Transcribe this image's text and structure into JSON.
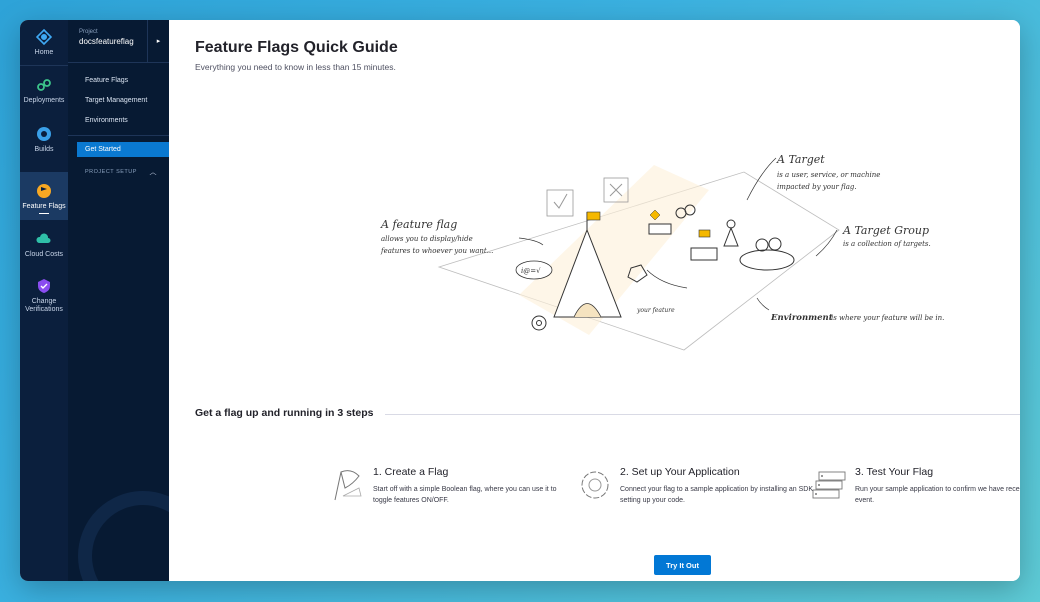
{
  "nav_rail": {
    "items": [
      {
        "label": "Home",
        "icon": "harness-logo-icon"
      },
      {
        "label": "Deployments",
        "icon": "deployments-icon"
      },
      {
        "label": "Builds",
        "icon": "builds-icon"
      },
      {
        "label": "Feature Flags",
        "icon": "feature-flags-icon",
        "active": true
      },
      {
        "label": "Cloud Costs",
        "icon": "cloud-costs-icon"
      },
      {
        "label": "Change Verifications",
        "icon": "change-verifications-icon"
      }
    ]
  },
  "project": {
    "label": "Project",
    "name": "docsfeatureflag"
  },
  "side_nav": {
    "links": [
      "Feature Flags",
      "Target Management",
      "Environments"
    ],
    "active": "Get Started",
    "section": "PROJECT SETUP"
  },
  "page": {
    "title": "Feature Flags Quick Guide",
    "subtitle": "Everything you need to know in less than 15 minutes."
  },
  "illustration": {
    "feature_flag_title": "A feature flag",
    "feature_flag_desc1": "allows you to display/hide",
    "feature_flag_desc2": "features to whoever you want...",
    "target_title": "A Target",
    "target_desc1": "is a user, service, or machine",
    "target_desc2": "impacted by your flag.",
    "group_title": "A Target Group",
    "group_desc": "is a collection of targets.",
    "env_title": "Environment",
    "env_desc": "is where your feature will be in.",
    "your_feature": "your feature"
  },
  "steps": {
    "heading": "Get a flag up and running in 3 steps",
    "items": [
      {
        "title": "1. Create a Flag",
        "desc": "Start off with a simple Boolean flag, where you can use it to toggle features ON/OFF.",
        "icon": "flag-icon"
      },
      {
        "title": "2. Set up Your Application",
        "desc": "Connect your flag to a sample application by installing an SDK setting up your code.",
        "icon": "gear-icon"
      },
      {
        "title": "3. Test Your Flag",
        "desc": "Run your sample application to confirm we have received an event.",
        "icon": "server-list-icon"
      }
    ]
  },
  "cta": {
    "label": "Try It Out"
  },
  "colors": {
    "accent": "#0278d5",
    "rail": "#0b1f3d",
    "sidebar": "#071a33",
    "flag_yellow": "#f5b800"
  }
}
